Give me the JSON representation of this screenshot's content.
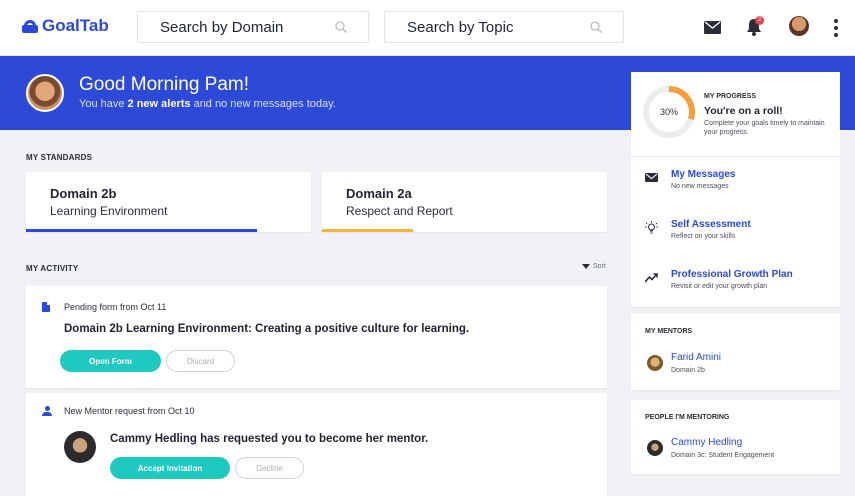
{
  "app": {
    "name": "GoalTab",
    "brand_color": "#2c49d8",
    "accent_teal": "#1fc9bf",
    "accent_orange": "#f3a03a"
  },
  "header": {
    "search_domain_placeholder": "Search by Domain",
    "search_topic_placeholder": "Search by Topic",
    "notification_count": "2",
    "icons": [
      "search-icon",
      "mail-icon",
      "bell-icon",
      "avatar",
      "more-vertical-icon"
    ]
  },
  "hero": {
    "greeting": "Good Morning Pam!",
    "sub_prefix": "You have ",
    "sub_bold": "2 new alerts",
    "sub_suffix": " and no new messages today."
  },
  "standards": {
    "label": "MY STANDARDS",
    "items": [
      {
        "title": "Domain 2b",
        "subtitle": "Learning Environment",
        "progress_percent": 81
      },
      {
        "title": "Domain 2a",
        "subtitle": "Respect and Report",
        "progress_percent": 32
      }
    ]
  },
  "activity": {
    "label": "MY ACTIVITY",
    "sort_label": "Sort",
    "items": [
      {
        "header": "Pending form from Oct 11",
        "title": "Domain 2b Learning Environment: Creating a positive culture for learning.",
        "primary_label": "Open Form",
        "secondary_label": "Discard"
      },
      {
        "header": "New Mentor request from Oct 10",
        "title": "Cammy Hedling has requested you to become her mentor.",
        "primary_label": "Accept Invitation",
        "secondary_label": "Decline"
      }
    ]
  },
  "progress": {
    "label": "MY PROGRESS",
    "percent_text": "30%",
    "percent": 30,
    "title": "You're on a roll!",
    "description": "Complete your goals timely to maintain your progress."
  },
  "quick_links": [
    {
      "title": "My Messages",
      "subtitle": "No new messages",
      "icon": "mail-icon"
    },
    {
      "title": "Self Assessment",
      "subtitle": "Reflect on your skills",
      "icon": "lightbulb-icon"
    },
    {
      "title": "Professional Growth Plan",
      "subtitle": "Revisit or edit your growth plan",
      "icon": "trending-up-icon"
    }
  ],
  "mentors": {
    "label": "MY MENTORS",
    "items": [
      {
        "name": "Farid Amini",
        "subtitle": "Domain 2b"
      }
    ]
  },
  "mentoring": {
    "label": "PEOPLE I'M MENTORING",
    "items": [
      {
        "name": "Cammy Hedling",
        "subtitle": "Domain 3c: Student Engagement"
      }
    ]
  }
}
